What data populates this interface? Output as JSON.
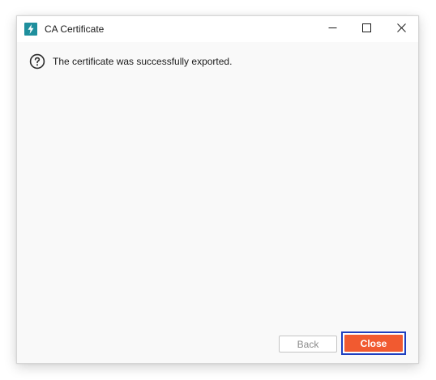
{
  "window": {
    "title": "CA Certificate",
    "icon": "lightning-app-icon",
    "controls": {
      "minimize_icon": "minimize-icon",
      "maximize_icon": "maximize-icon",
      "close_icon": "close-icon"
    }
  },
  "message": {
    "icon": "question-circle-icon",
    "text": "The certificate was successfully exported."
  },
  "buttons": {
    "back_label": "Back",
    "back_enabled": false,
    "close_label": "Close"
  },
  "colors": {
    "app_icon_bg": "#1f8f9d",
    "close_button_bg": "#f15a30",
    "focus_outline": "#1e3fbf",
    "dialog_bg": "#f9f9f9"
  }
}
